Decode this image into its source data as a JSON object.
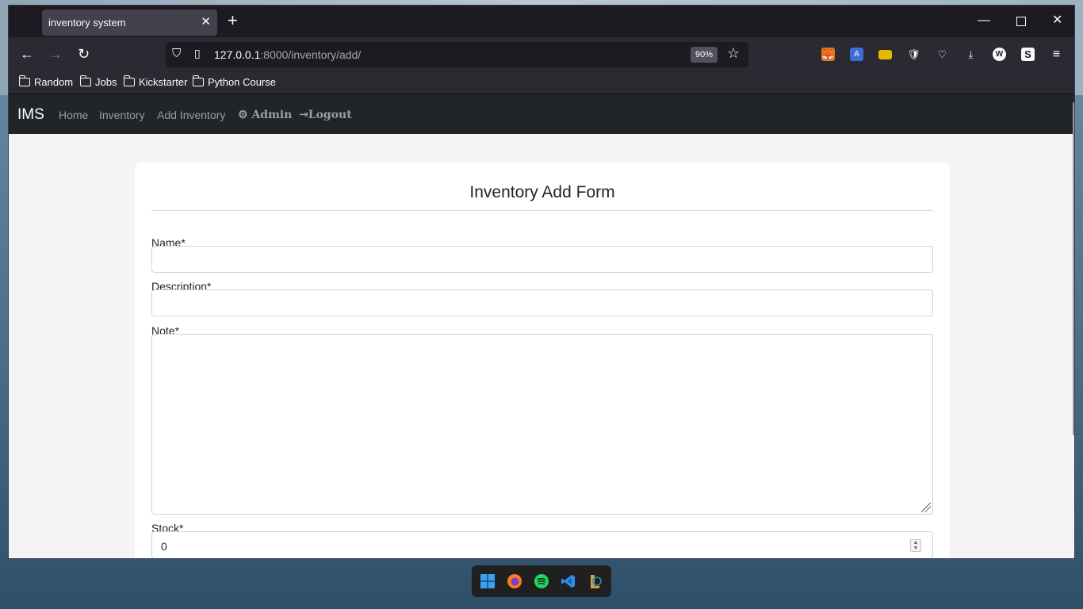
{
  "browser": {
    "tab_title": "inventory system",
    "tab_close": "✕",
    "new_tab": "+",
    "url_host": "127.0.0.1",
    "url_rest": ":8000/inventory/add/",
    "zoom": "90%",
    "bookmarks": [
      "Random",
      "Jobs",
      "Kickstarter",
      "Python Course"
    ]
  },
  "app": {
    "brand": "IMS",
    "nav": {
      "home": "Home",
      "inventory": "Inventory",
      "add_inventory": "Add Inventory",
      "admin": "Admin",
      "logout": "Logout"
    }
  },
  "form": {
    "title": "Inventory Add Form",
    "name_label": "Name*",
    "description_label": "Description*",
    "note_label": "Note*",
    "stock_label": "Stock*",
    "stock_value": "0"
  },
  "colors": {
    "navbar": "#212529",
    "page_bg": "#f4f4f4",
    "card": "#ffffff"
  }
}
